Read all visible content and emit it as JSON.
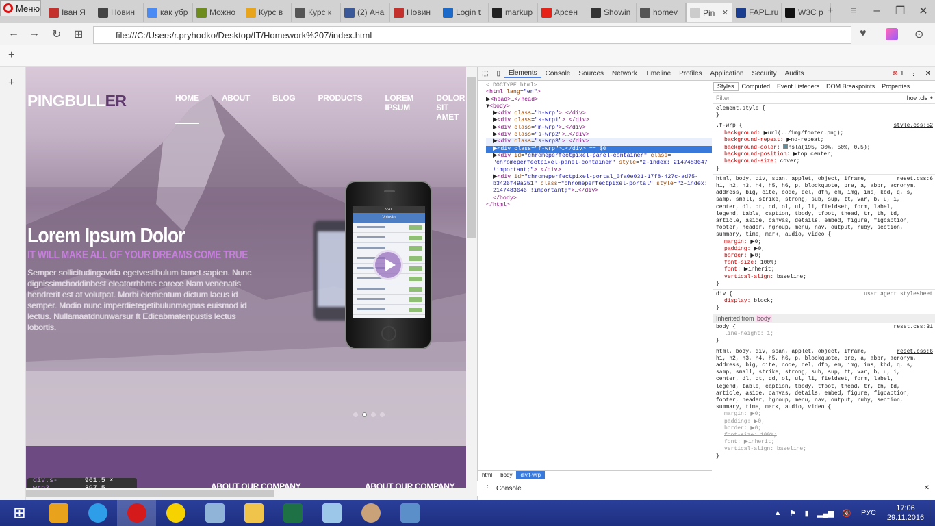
{
  "browser": {
    "menu_label": "Меню",
    "tabs": [
      {
        "label": "Іван Я",
        "fav": "#c4302b",
        "icon": "hack-icon"
      },
      {
        "label": "Новин",
        "fav": "#444",
        "icon": "e-icon"
      },
      {
        "label": "как убр",
        "fav": "#4a8af4",
        "icon": "google-icon"
      },
      {
        "label": "Можно",
        "fav": "#6e8b1e",
        "icon": "stackexchange-icon"
      },
      {
        "label": "Курс в",
        "fav": "#e8a41a",
        "icon": "course-icon"
      },
      {
        "label": "Курс к",
        "fav": "#555",
        "icon": "shield-icon"
      },
      {
        "label": "(2) Ана",
        "fav": "#3b5998",
        "icon": "facebook-icon"
      },
      {
        "label": "Новин",
        "fav": "#c4302b",
        "icon": "news-icon"
      },
      {
        "label": "Login t",
        "fav": "#1b6ac9",
        "icon": "skype-icon"
      },
      {
        "label": "markup",
        "fav": "#222",
        "icon": "github-icon"
      },
      {
        "label": "Арсен",
        "fav": "#e62117",
        "icon": "youtube-icon"
      },
      {
        "label": "Showin",
        "fav": "#333",
        "icon": "wiki-icon"
      },
      {
        "label": "homev",
        "fav": "#555",
        "icon": "hash-icon"
      },
      {
        "label": "Pin",
        "fav": "#ccc",
        "icon": "page-icon",
        "active": true
      },
      {
        "label": "FAPL.ru",
        "fav": "#1a3d8f",
        "icon": "fapl-icon"
      },
      {
        "label": "W3C p",
        "fav": "#111",
        "icon": "w3c-icon"
      }
    ],
    "url": "file:///C:/Users/r.pryhodko/Desktop/IT/Homework%207/index.html"
  },
  "site": {
    "logo_light": "PINGBULL",
    "logo_dark": "ER",
    "nav": [
      "HOME",
      "ABOUT",
      "BLOG",
      "PRODUCTS",
      "LOREM IPSUM",
      "DOLOR SIT AMET"
    ],
    "headline": "Lorem Ipsum Dolor",
    "subheadline": "IT WILL MAKE ALL OF YOUR DREAMS COME TRUE",
    "paragraph": "Semper sollicitudingavida egetvestibulum tamet sapien. Nunc dignissimchoddinbest eleatorrhbms earece Nam venenatis hendrerit est at volutpat. Morbi elementum dictum lacus id semper. Modio nunc imperdietegetibulunmagnas euismod id lectus. Nullamaatdnunwarsur ft Edicabmatenpustis lectus lobortis.",
    "phone_screen_title": "Volusio",
    "sections": [
      "ABOUT OUR COMPANY",
      "ABOUT OUR COMPANY"
    ]
  },
  "tooltip": {
    "selector": "div.s-wrp3",
    "size": "961.5 × 397.5"
  },
  "devtools": {
    "tabs": [
      "Elements",
      "Console",
      "Sources",
      "Network",
      "Timeline",
      "Profiles",
      "Application",
      "Security",
      "Audits"
    ],
    "error_count": "1",
    "style_tabs": [
      "Styles",
      "Computed",
      "Event Listeners",
      "DOM Breakpoints",
      "Properties"
    ],
    "filter_placeholder": "Filter",
    "hov": ":hov",
    "cls": ".cls",
    "breadcrumb": [
      "html",
      "body",
      "div.f-wrp"
    ],
    "console_label": "Console",
    "inherited_label": "Inherited from",
    "inherited_tag": "body"
  },
  "taskbar": {
    "lang": "РУС",
    "time": "17:06",
    "date": "29.11.2016"
  }
}
